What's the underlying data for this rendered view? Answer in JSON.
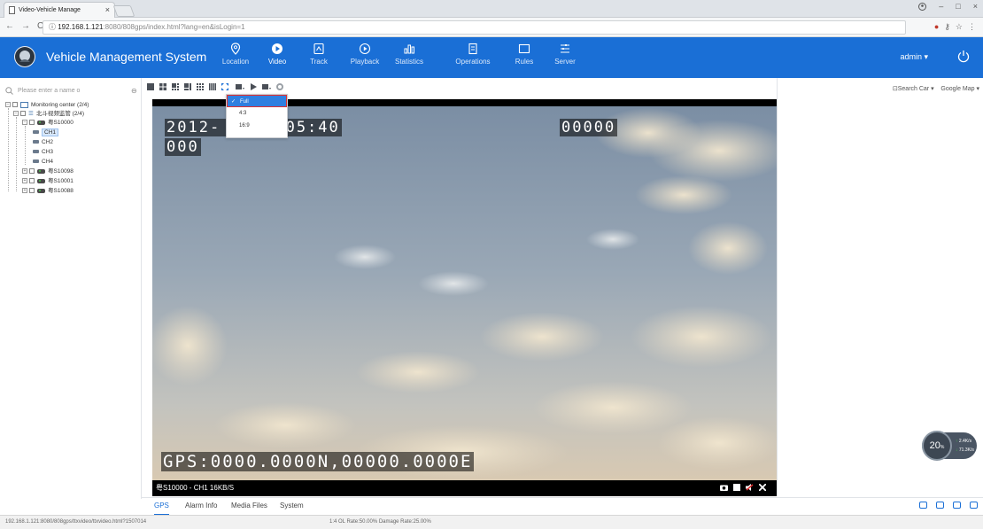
{
  "browser": {
    "tab_title": "Video-Vehicle Manage",
    "tab_close": "×",
    "url_host": "192.168.1.121",
    "url_rest": ":8080/808gps/index.html?lang=en&isLogin=1",
    "status_url": "192.168.1.121:8080/808gps/ttxvideo/ttxvideo.html?1507014",
    "window_controls": [
      "–",
      "□",
      "×"
    ]
  },
  "header": {
    "app_title": "Vehicle Management System",
    "nav": [
      {
        "label": "Location",
        "icon": "location-pin-icon"
      },
      {
        "label": "Video",
        "icon": "video-play-icon",
        "active": true
      },
      {
        "label": "Track",
        "icon": "track-icon"
      },
      {
        "label": "Playback",
        "icon": "playback-icon"
      },
      {
        "label": "Statistics",
        "icon": "statistics-icon"
      },
      {
        "label": "Operations",
        "icon": "operations-icon"
      },
      {
        "label": "Rules",
        "icon": "rules-icon"
      },
      {
        "label": "Server",
        "icon": "server-icon"
      }
    ],
    "user": "admin",
    "accent": "#1a6fd6"
  },
  "sidebar": {
    "search_placeholder": "Please enter a name o",
    "tree": {
      "root": "Monitoring center  (2/4)",
      "group": "北斗视频监管  (2/4)",
      "vehicle1": "粤S10000",
      "channels": [
        "CH1",
        "CH2",
        "CH3",
        "CH4"
      ],
      "vehicle2": "粤S10098",
      "vehicle3": "粤S10001",
      "vehicle4": "粤S10088"
    }
  },
  "dropdown": {
    "items": [
      "Full",
      "4:3",
      "16:9"
    ],
    "selected": "Full",
    "check": "✓"
  },
  "video": {
    "osd_time": "2012-    5  16:05:40",
    "osd_time_line2": "000",
    "osd_code": "00000",
    "osd_gps": "GPS:0000.0000N,00000.0000E",
    "status": "粤S10000 - CH1 16KB/S"
  },
  "right": {
    "search_car": "Search Car",
    "map": "Google Map",
    "speed_value": "20",
    "speed_unit": "%",
    "up_rate": "2.4K/s",
    "down_rate": "71.3K/s"
  },
  "bottom_tabs": [
    "GPS",
    "Alarm Info",
    "Media Files",
    "System"
  ],
  "statusbar": {
    "rate": "1:4   OL Rate:50.00%   Damage Rate:25.00%"
  }
}
